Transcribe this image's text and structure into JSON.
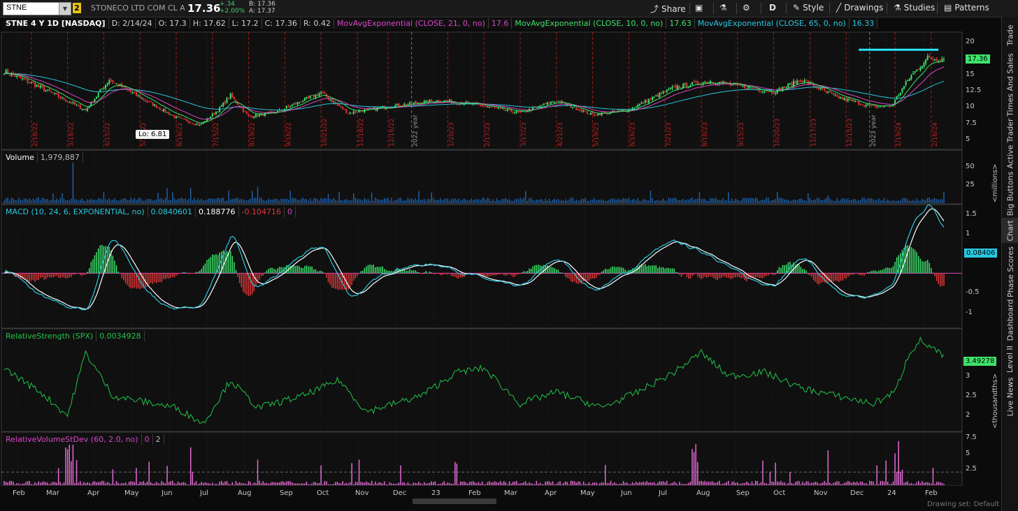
{
  "toolbar": {
    "symbol": "STNE",
    "link_group": "2",
    "company": "STONECO LTD COM CL A",
    "last": "17.36",
    "change": "+.34",
    "change_pct": "+2.00%",
    "bid": "B: 17.36",
    "ask": "A: 17.37",
    "share": "Share",
    "period": "D",
    "style": "Style",
    "drawings": "Drawings",
    "studies": "Studies",
    "patterns": "Patterns"
  },
  "price_pane": {
    "title": "STNE 4 Y 1D [NASDAQ]",
    "date": "D: 2/14/24",
    "open": "O: 17.3",
    "high": "H: 17.62",
    "low": "L: 17.2",
    "close": "C: 17.36",
    "range": "R: 0.42",
    "ma1_label": "MovAvgExponential (CLOSE, 21, 0, no)",
    "ma1_value": "17.6",
    "ma2_label": "MovAvgExponential (CLOSE, 10, 0, no)",
    "ma2_value": "17.63",
    "ma3_label": "MovAvgExponential (CLOSE, 65, 0, no)",
    "ma3_value": "16.33",
    "last_badge": "17.36",
    "lo_annotation": "Lo: 6.81",
    "axis": [
      "20",
      "17.5",
      "15",
      "12.5",
      "10",
      "7.5",
      "5"
    ],
    "date_markers": [
      "2/18/22",
      "3/18/22",
      "4/15/22",
      "5/17/22",
      "6/16/22",
      "7/15/22",
      "8/19/22",
      "9/16/22",
      "10/21/22",
      "11/18/22",
      "12/16/22",
      "2022 year",
      "1/20/23",
      "2/17/23",
      "3/17/23",
      "4/21/23",
      "5/19/23",
      "6/16/23",
      "7/21/23",
      "8/18/23",
      "9/15/23",
      "10/20/23",
      "11/17/23",
      "12/15/23",
      "2023 year",
      "1/19/24",
      "2/16/24"
    ]
  },
  "volume_pane": {
    "title": "Volume",
    "value": "1,979,887",
    "axis": [
      "50",
      "25"
    ],
    "unit": "<millions>"
  },
  "macd_pane": {
    "title": "MACD (10, 24, 6, EXPONENTIAL, no)",
    "v1": "0.0840601",
    "v2": "0.188776",
    "v3": "-0.104716",
    "v4": "0",
    "badge": "0.08406",
    "axis": [
      "1.5",
      "1",
      "0.5",
      "-0.5",
      "-1"
    ]
  },
  "rs_pane": {
    "title": "RelativeStrength (SPX)",
    "value": "0.0034928",
    "badge": "3.49278",
    "axis": [
      "3",
      "2.5",
      "2"
    ],
    "unit": "<thousandths>"
  },
  "rvs_pane": {
    "title": "RelativeVolumeStDev (60, 2.0, no)",
    "v1": "0",
    "v2": "2",
    "axis": [
      "7.5",
      "5",
      "2.5"
    ]
  },
  "months": [
    "Feb",
    "Mar",
    "Apr",
    "May",
    "Jun",
    "Jul",
    "Aug",
    "Sep",
    "Oct",
    "Nov",
    "Dec",
    "23",
    "Feb",
    "Mar",
    "Apr",
    "May",
    "Jun",
    "Jul",
    "Aug",
    "Sep",
    "Oct",
    "Nov",
    "Dec",
    "24",
    "Feb"
  ],
  "side_tabs": [
    "Trade",
    "Times And Sales",
    "Active Trader",
    "Big Buttons",
    "Chart",
    "Phase Scores",
    "Dashboard",
    "Level II",
    "Live News"
  ],
  "status": "Drawing set: Default",
  "colors": {
    "up": "#3ee36b",
    "down": "#e0383a",
    "ma_pink": "#d946c8",
    "ma_cyan": "#29c7e0",
    "rs": "#22c34a",
    "macd_white": "#ffffff"
  }
}
